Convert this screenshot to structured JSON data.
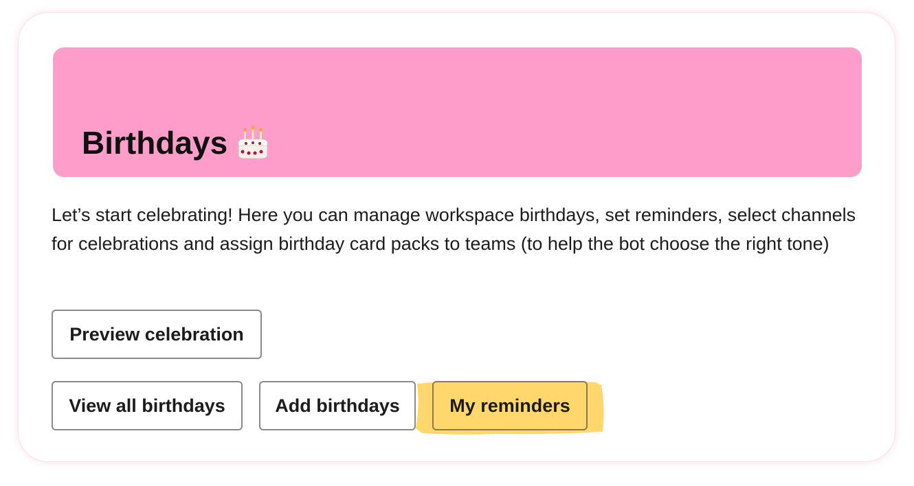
{
  "header": {
    "title": "Birthdays",
    "banner_color": "#ff9dca",
    "title_icon": "birthday-cake-icon"
  },
  "description": "Let’s start celebrating! Here you can manage workspace birthdays, set reminders, select channels for celebrations and assign birthday card packs to teams (to help the bot choose the right tone)",
  "actions": {
    "preview_label": "Preview celebration",
    "view_all_label": "View all birthdays",
    "add_label": "Add birthdays",
    "reminders_label": "My reminders",
    "highlight_color": "#ffd76d"
  }
}
